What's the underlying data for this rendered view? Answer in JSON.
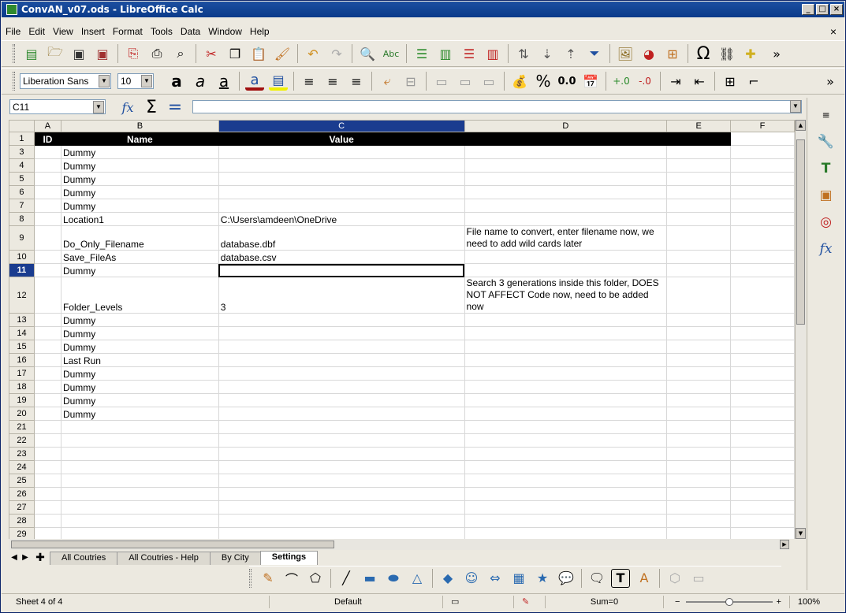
{
  "window": {
    "title": "ConvAN_v07.ods - LibreOffice Calc",
    "controls": [
      "_",
      "□",
      "×"
    ]
  },
  "menu": {
    "items": [
      "File",
      "Edit",
      "View",
      "Insert",
      "Format",
      "Tools",
      "Data",
      "Window",
      "Help"
    ],
    "close_doc": "×"
  },
  "formatting": {
    "font_name": "Liberation Sans",
    "font_size": "10"
  },
  "formula": {
    "cell_ref": "C11",
    "content": ""
  },
  "columns": [
    "A",
    "B",
    "C",
    "D",
    "E",
    "F"
  ],
  "selected_column": "C",
  "selected_row": "11",
  "rows": [
    {
      "num": "1",
      "header": true,
      "cells": [
        "ID",
        "Name",
        "Value",
        "",
        "",
        ""
      ]
    },
    {
      "num": "3",
      "cells": [
        "",
        "Dummy",
        "",
        "",
        "",
        ""
      ]
    },
    {
      "num": "4",
      "cells": [
        "",
        "Dummy",
        "",
        "",
        "",
        ""
      ]
    },
    {
      "num": "5",
      "cells": [
        "",
        "Dummy",
        "",
        "",
        "",
        ""
      ]
    },
    {
      "num": "6",
      "cells": [
        "",
        "Dummy",
        "",
        "",
        "",
        ""
      ]
    },
    {
      "num": "7",
      "cells": [
        "",
        "Dummy",
        "",
        "",
        "",
        ""
      ]
    },
    {
      "num": "8",
      "cells": [
        "",
        "Location1",
        "C:\\Users\\amdeen\\OneDrive",
        "",
        "",
        ""
      ]
    },
    {
      "num": "9",
      "tall": 31,
      "cells": [
        "",
        "Do_Only_Filename",
        "database.dbf",
        "File name to convert, enter filename now, we need to add wild cards later",
        "",
        ""
      ]
    },
    {
      "num": "10",
      "cells": [
        "",
        "Save_FileAs",
        "database.csv",
        "",
        "",
        ""
      ]
    },
    {
      "num": "11",
      "cells": [
        "",
        "Dummy",
        "",
        "",
        "",
        ""
      ]
    },
    {
      "num": "12",
      "tall": 46,
      "cells": [
        "",
        "Folder_Levels",
        "3",
        "Search 3 generations inside this folder, DOES NOT AFFECT Code now, need to be added now",
        "",
        ""
      ]
    },
    {
      "num": "13",
      "cells": [
        "",
        "Dummy",
        "",
        "",
        "",
        ""
      ]
    },
    {
      "num": "14",
      "cells": [
        "",
        "Dummy",
        "",
        "",
        "",
        ""
      ]
    },
    {
      "num": "15",
      "cells": [
        "",
        "Dummy",
        "",
        "",
        "",
        ""
      ]
    },
    {
      "num": "16",
      "cells": [
        "",
        "Last Run",
        "",
        "",
        "",
        ""
      ]
    },
    {
      "num": "17",
      "cells": [
        "",
        "Dummy",
        "",
        "",
        "",
        ""
      ]
    },
    {
      "num": "18",
      "cells": [
        "",
        "Dummy",
        "",
        "",
        "",
        ""
      ]
    },
    {
      "num": "19",
      "cells": [
        "",
        "Dummy",
        "",
        "",
        "",
        ""
      ]
    },
    {
      "num": "20",
      "cells": [
        "",
        "Dummy",
        "",
        "",
        "",
        ""
      ]
    },
    {
      "num": "21",
      "cells": [
        "",
        "",
        "",
        "",
        "",
        ""
      ]
    },
    {
      "num": "22",
      "cells": [
        "",
        "",
        "",
        "",
        "",
        ""
      ]
    },
    {
      "num": "23",
      "cells": [
        "",
        "",
        "",
        "",
        "",
        ""
      ]
    },
    {
      "num": "24",
      "cells": [
        "",
        "",
        "",
        "",
        "",
        ""
      ]
    },
    {
      "num": "25",
      "cells": [
        "",
        "",
        "",
        "",
        "",
        ""
      ]
    },
    {
      "num": "26",
      "cells": [
        "",
        "",
        "",
        "",
        "",
        ""
      ]
    },
    {
      "num": "27",
      "cells": [
        "",
        "",
        "",
        "",
        "",
        ""
      ]
    },
    {
      "num": "28",
      "cells": [
        "",
        "",
        "",
        "",
        "",
        ""
      ]
    },
    {
      "num": "29",
      "cells": [
        "",
        "",
        "",
        "",
        "",
        ""
      ]
    }
  ],
  "sheet_tabs": [
    "All Coutries",
    "All Coutries - Help",
    "By City",
    "Settings"
  ],
  "active_tab": "Settings",
  "status": {
    "sheet": "Sheet 4 of 4",
    "style": "Default",
    "sum": "Sum=0",
    "zoom": "100%",
    "zoom_level": 1.0
  },
  "colors": {
    "header_bg": "#000000",
    "selection": "#1a3c8f",
    "title_bar": "#0a3a8a"
  }
}
